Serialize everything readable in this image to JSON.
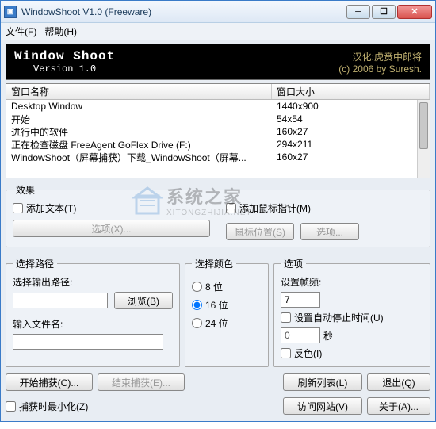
{
  "window": {
    "title": "WindowShoot V1.0 (Freeware)"
  },
  "menu": {
    "file": "文件(F)",
    "help": "帮助(H)"
  },
  "banner": {
    "title": "Window Shoot",
    "version": "Version 1.0",
    "credit1": "汉化:虎贲中郎将",
    "credit2": "(c) 2006 by Suresh."
  },
  "table": {
    "col1": "窗口名称",
    "col2": "窗口大小",
    "rows": [
      {
        "name": "Desktop Window",
        "size": "1440x900"
      },
      {
        "name": "开始",
        "size": "54x54"
      },
      {
        "name": "进行中的软件",
        "size": "160x27"
      },
      {
        "name": "正在检查磁盘 FreeAgent GoFlex Drive (F:)",
        "size": "294x211"
      },
      {
        "name": "WindowShoot（屏幕捕获）下载_WindowShoot（屏幕...",
        "size": "160x27"
      }
    ]
  },
  "effects": {
    "legend": "效果",
    "add_text": "添加文本(T)",
    "text_options": "选项(X)...",
    "add_cursor": "添加鼠标指针(M)",
    "cursor_pos": "鼠标位置(S)",
    "options_btn": "选项..."
  },
  "path": {
    "legend": "选择路径",
    "out_label": "选择输出路径:",
    "browse": "浏览(B)",
    "file_label": "输入文件名:",
    "out_value": "",
    "file_value": ""
  },
  "colors": {
    "legend": "选择颜色",
    "opt8": "8 位",
    "opt16": "16 位",
    "opt24": "24 位"
  },
  "options": {
    "legend": "选项",
    "fps_label": "设置帧频:",
    "fps_value": "7",
    "auto_stop": "设置自动停止时间(U)",
    "auto_stop_value": "0",
    "seconds": "秒",
    "invert": "反色(I)"
  },
  "buttons": {
    "start": "开始捕获(C)...",
    "end": "结束捕获(E)...",
    "refresh": "刷新列表(L)",
    "exit": "退出(Q)",
    "minimize": "捕获时最小化(Z)",
    "website": "访问网站(V)",
    "about": "关于(A)..."
  },
  "watermark": {
    "main": "系统之家",
    "sub": "XITONGZHIJIA.NET"
  }
}
